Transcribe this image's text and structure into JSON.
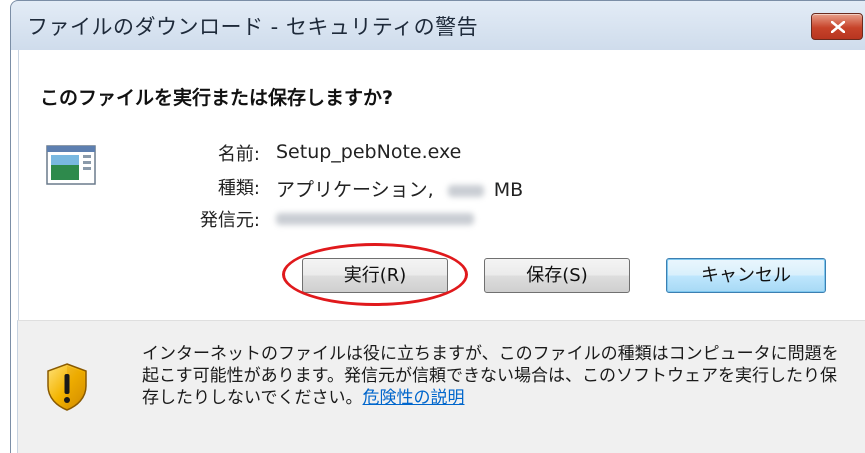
{
  "window": {
    "title": "ファイルのダウンロード - セキュリティの警告"
  },
  "dialog": {
    "question": "このファイルを実行または保存しますか?",
    "fields": {
      "name_label": "名前:",
      "name_value": "Setup_pebNote.exe",
      "type_label": "種類:",
      "type_value": "アプリケーション,",
      "type_size_unit": "MB",
      "publisher_label": "発信元:"
    },
    "buttons": {
      "run": "実行(R)",
      "save": "保存(S)",
      "cancel": "キャンセル"
    },
    "warning": {
      "text": "インターネットのファイルは役に立ちますが、このファイルの種類はコンピュータに問題を起こす可能性があります。発信元が信頼できない場合は、このソフトウェアを実行したり保存したりしないでください。",
      "link": "危険性の説明"
    }
  },
  "icons": {
    "close": "close-icon",
    "file": "application-file-icon",
    "shield": "security-shield-warning-icon"
  },
  "colors": {
    "highlight_ellipse": "#e0191c",
    "link": "#0066cc",
    "default_button_border": "#3c7fb1"
  }
}
